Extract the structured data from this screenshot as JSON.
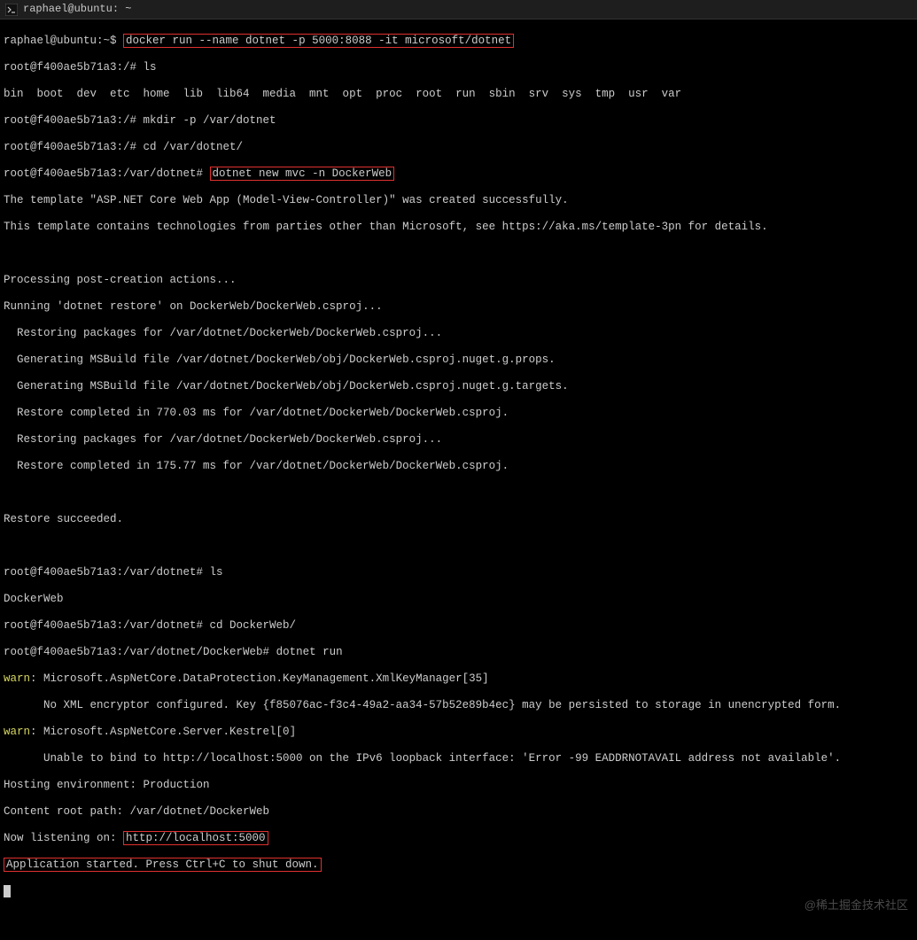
{
  "window": {
    "title": "raphael@ubuntu: ~"
  },
  "prompts": {
    "p0": "raphael@ubuntu:~$ ",
    "p1": "root@f400ae5b71a3:/# ",
    "p2": "root@f400ae5b71a3:/var/dotnet# ",
    "p3": "root@f400ae5b71a3:/var/dotnet/DockerWeb# "
  },
  "cmd": {
    "docker": "docker run --name dotnet -p 5000:8088 -it microsoft/dotnet",
    "ls1": "ls",
    "mkdir": "mkdir -p /var/dotnet",
    "cd1": "cd /var/dotnet/",
    "newmvc": "dotnet new mvc -n DockerWeb",
    "ls2": "ls",
    "cd2": "cd DockerWeb/",
    "run": "dotnet run"
  },
  "out": {
    "dirlist": "bin  boot  dev  etc  home  lib  lib64  media  mnt  opt  proc  root  run  sbin  srv  sys  tmp  usr  var",
    "tmpl1": "The template \"ASP.NET Core Web App (Model-View-Controller)\" was created successfully.",
    "tmpl2": "This template contains technologies from parties other than Microsoft, see https://aka.ms/template-3pn for details.",
    "proc1": "Processing post-creation actions...",
    "proc2": "Running 'dotnet restore' on DockerWeb/DockerWeb.csproj...",
    "proc3": "  Restoring packages for /var/dotnet/DockerWeb/DockerWeb.csproj...",
    "proc4": "  Generating MSBuild file /var/dotnet/DockerWeb/obj/DockerWeb.csproj.nuget.g.props.",
    "proc5": "  Generating MSBuild file /var/dotnet/DockerWeb/obj/DockerWeb.csproj.nuget.g.targets.",
    "proc6": "  Restore completed in 770.03 ms for /var/dotnet/DockerWeb/DockerWeb.csproj.",
    "proc7": "  Restoring packages for /var/dotnet/DockerWeb/DockerWeb.csproj...",
    "proc8": "  Restore completed in 175.77 ms for /var/dotnet/DockerWeb/DockerWeb.csproj.",
    "restore": "Restore succeeded.",
    "lsout": "DockerWeb",
    "warn": "warn",
    "w1a": ": Microsoft.AspNetCore.DataProtection.KeyManagement.XmlKeyManager[35]",
    "w1b": "      No XML encryptor configured. Key {f85076ac-f3c4-49a2-aa34-57b52e89b4ec} may be persisted to storage in unencrypted form.",
    "w2a": ": Microsoft.AspNetCore.Server.Kestrel[0]",
    "w2b": "      Unable to bind to http://localhost:5000 on the IPv6 loopback interface: 'Error -99 EADDRNOTAVAIL address not available'.",
    "host1": "Hosting environment: Production",
    "host2": "Content root path: /var/dotnet/DockerWeb",
    "host3a": "Now listening on: ",
    "host3b": "http://localhost:5000",
    "host4": "Application started. Press Ctrl+C to shut down."
  },
  "watermark": "@稀土掘金技术社区"
}
